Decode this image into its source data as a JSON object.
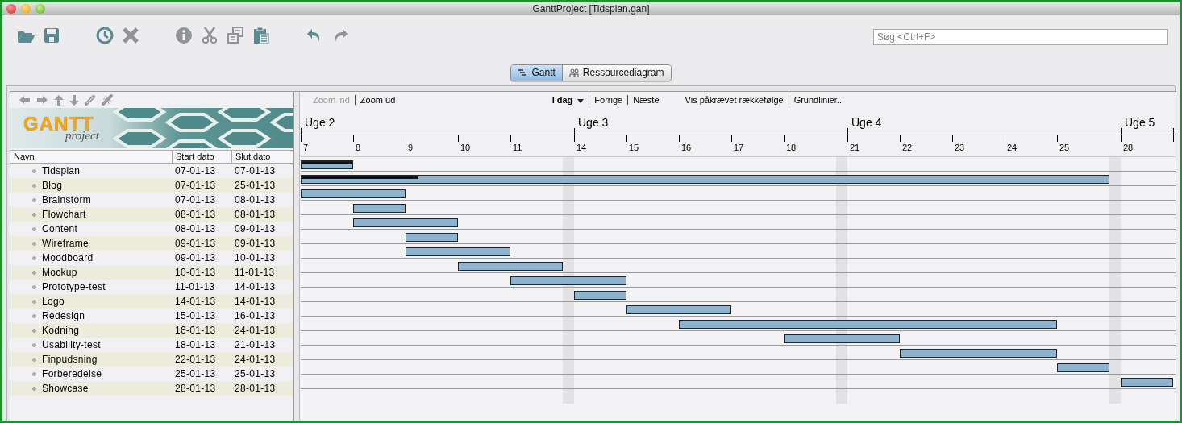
{
  "window": {
    "title": "GanttProject [Tidsplan.gan]"
  },
  "search": {
    "placeholder": "Søg <Ctrl+F>"
  },
  "tabs": [
    {
      "label": "Gantt",
      "selected": true
    },
    {
      "label": "Ressourcediagram",
      "selected": false
    }
  ],
  "logo": {
    "title": "GANTT",
    "subtitle": "project"
  },
  "table": {
    "columns": [
      "Navn",
      "Start dato",
      "Slut dato"
    ],
    "rows": [
      {
        "name": "Tidsplan",
        "start": "07-01-13",
        "end": "07-01-13",
        "kind": "summary",
        "level": 1
      },
      {
        "name": "Blog",
        "start": "07-01-13",
        "end": "25-01-13",
        "kind": "summary",
        "level": 0.145
      },
      {
        "name": "Brainstorm",
        "start": "07-01-13",
        "end": "08-01-13",
        "kind": "task"
      },
      {
        "name": "Flowchart",
        "start": "08-01-13",
        "end": "08-01-13",
        "kind": "task"
      },
      {
        "name": "Content",
        "start": "08-01-13",
        "end": "09-01-13",
        "kind": "task"
      },
      {
        "name": "Wireframe",
        "start": "09-01-13",
        "end": "09-01-13",
        "kind": "task"
      },
      {
        "name": "Moodboard",
        "start": "09-01-13",
        "end": "10-01-13",
        "kind": "task"
      },
      {
        "name": "Mockup",
        "start": "10-01-13",
        "end": "11-01-13",
        "kind": "task"
      },
      {
        "name": "Prototype-test",
        "start": "11-01-13",
        "end": "14-01-13",
        "kind": "task"
      },
      {
        "name": "Logo",
        "start": "14-01-13",
        "end": "14-01-13",
        "kind": "task"
      },
      {
        "name": "Redesign",
        "start": "15-01-13",
        "end": "16-01-13",
        "kind": "task"
      },
      {
        "name": "Kodning",
        "start": "16-01-13",
        "end": "24-01-13",
        "kind": "task"
      },
      {
        "name": "Usability-test",
        "start": "18-01-13",
        "end": "21-01-13",
        "kind": "task"
      },
      {
        "name": "Finpudsning",
        "start": "22-01-13",
        "end": "24-01-13",
        "kind": "task"
      },
      {
        "name": "Forberedelse",
        "start": "25-01-13",
        "end": "25-01-13",
        "kind": "task"
      },
      {
        "name": "Showcase",
        "start": "28-01-13",
        "end": "28-01-13",
        "kind": "task"
      }
    ]
  },
  "chart_toolbar": [
    {
      "items": [
        {
          "label": "Zoom ind",
          "disabled": true,
          "bold": false,
          "dropdown": false
        },
        {
          "label": "Zoom ud",
          "disabled": false,
          "bold": false,
          "dropdown": false
        }
      ]
    },
    {
      "items": [
        {
          "label": "I dag",
          "disabled": false,
          "bold": true,
          "dropdown": true
        },
        {
          "label": "Forrige",
          "disabled": false,
          "bold": false,
          "dropdown": false
        },
        {
          "label": "Næste",
          "disabled": false,
          "bold": false,
          "dropdown": false
        }
      ]
    },
    {
      "items": [
        {
          "label": "Vis påkrævet rækkefølge",
          "disabled": false,
          "bold": false,
          "dropdown": false
        },
        {
          "label": "Grundlinier...",
          "disabled": false,
          "bold": false,
          "dropdown": false
        }
      ]
    }
  ],
  "timeline": {
    "weeks": [
      {
        "label": "Uge 2",
        "days": [
          "7",
          "8",
          "9",
          "10",
          "11"
        ]
      },
      {
        "label": "Uge 3",
        "days": [
          "14",
          "15",
          "16",
          "17",
          "18"
        ]
      },
      {
        "label": "Uge 4",
        "days": [
          "21",
          "22",
          "23",
          "24",
          "25"
        ]
      },
      {
        "label": "Uge 5",
        "days": [
          "28"
        ]
      }
    ]
  }
}
